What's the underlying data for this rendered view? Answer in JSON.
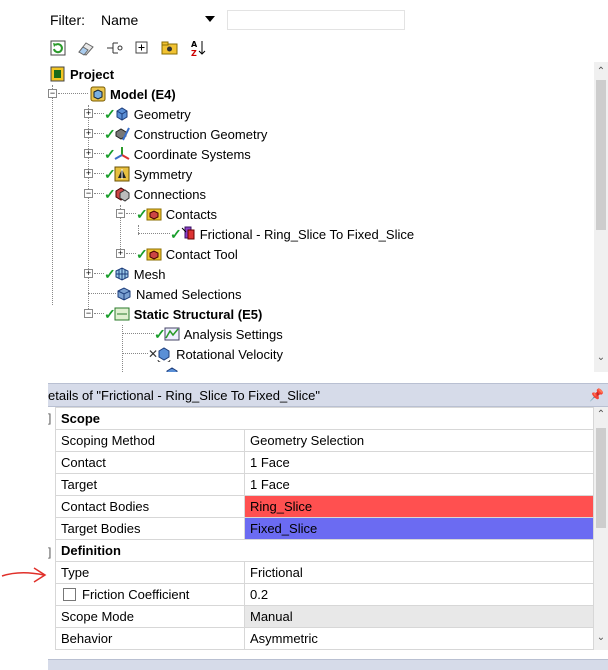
{
  "filter": {
    "label": "Filter:",
    "selected": "Name",
    "query": ""
  },
  "tree": {
    "nodes": [
      {
        "label": "Project",
        "bold": true
      },
      {
        "label": "Model (E4)",
        "bold": true
      },
      {
        "label": "Geometry"
      },
      {
        "label": "Construction Geometry"
      },
      {
        "label": "Coordinate Systems"
      },
      {
        "label": "Symmetry"
      },
      {
        "label": "Connections"
      },
      {
        "label": "Contacts"
      },
      {
        "label": "Frictional - Ring_Slice To Fixed_Slice"
      },
      {
        "label": "Contact Tool"
      },
      {
        "label": "Mesh"
      },
      {
        "label": "Named Selections"
      },
      {
        "label": "Static Structural (E5)",
        "bold": true
      },
      {
        "label": "Analysis Settings"
      },
      {
        "label": "Rotational Velocity"
      }
    ]
  },
  "details": {
    "title": "etails of \"Frictional - Ring_Slice To Fixed_Slice\"",
    "rows": [
      {
        "section": true,
        "label": "Scope"
      },
      {
        "label": "Scoping Method",
        "value": "Geometry Selection"
      },
      {
        "label": "Contact",
        "value": "1 Face"
      },
      {
        "label": "Target",
        "value": "1 Face"
      },
      {
        "label": "Contact Bodies",
        "value": "Ring_Slice",
        "bg": "#ff5050"
      },
      {
        "label": "Target Bodies",
        "value": "Fixed_Slice",
        "bg": "#6b6bf2"
      },
      {
        "section": true,
        "label": "Definition"
      },
      {
        "label": "Type",
        "value": "Frictional"
      },
      {
        "label": "Friction Coefficient",
        "value": "0.2",
        "checkbox": true
      },
      {
        "label": "Scope Mode",
        "value": "Manual",
        "bg": "#e8e8e8"
      },
      {
        "label": "Behavior",
        "value": "Asymmetric"
      }
    ]
  },
  "colors": {
    "check": "#1a9e2c",
    "arrow": "#e0302a",
    "header": "#d6dbe9",
    "contact": "#ff5050",
    "target": "#6b6bf2"
  }
}
